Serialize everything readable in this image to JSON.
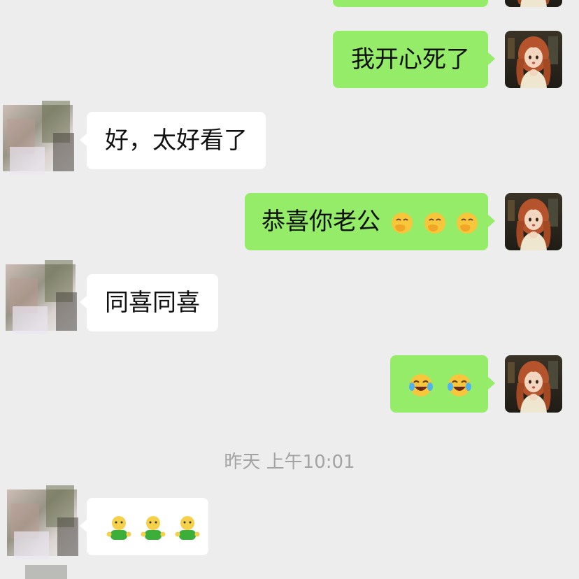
{
  "messages": [
    {
      "side": "outgoing",
      "text": "我开心死了"
    },
    {
      "side": "incoming",
      "text": "好，太好看了"
    },
    {
      "side": "outgoing",
      "text": "恭喜你老公",
      "emoji": [
        "face-with-hand-over-mouth",
        "face-with-hand-over-mouth",
        "face-with-hand-over-mouth"
      ]
    },
    {
      "side": "incoming",
      "text": "同喜同喜"
    },
    {
      "side": "outgoing",
      "text": "",
      "emoji": [
        "face-with-tears-of-joy",
        "face-with-tears-of-joy"
      ]
    },
    {
      "side": "incoming",
      "text": "",
      "emoji": [
        "green-sticker-figure",
        "green-sticker-figure",
        "green-sticker-figure"
      ]
    }
  ],
  "timestamp": "昨天 上午10:01",
  "colors": {
    "background": "#ededed",
    "outgoing_bubble": "#95ec69",
    "incoming_bubble": "#ffffff",
    "timestamp_text": "#a3a3a3"
  }
}
